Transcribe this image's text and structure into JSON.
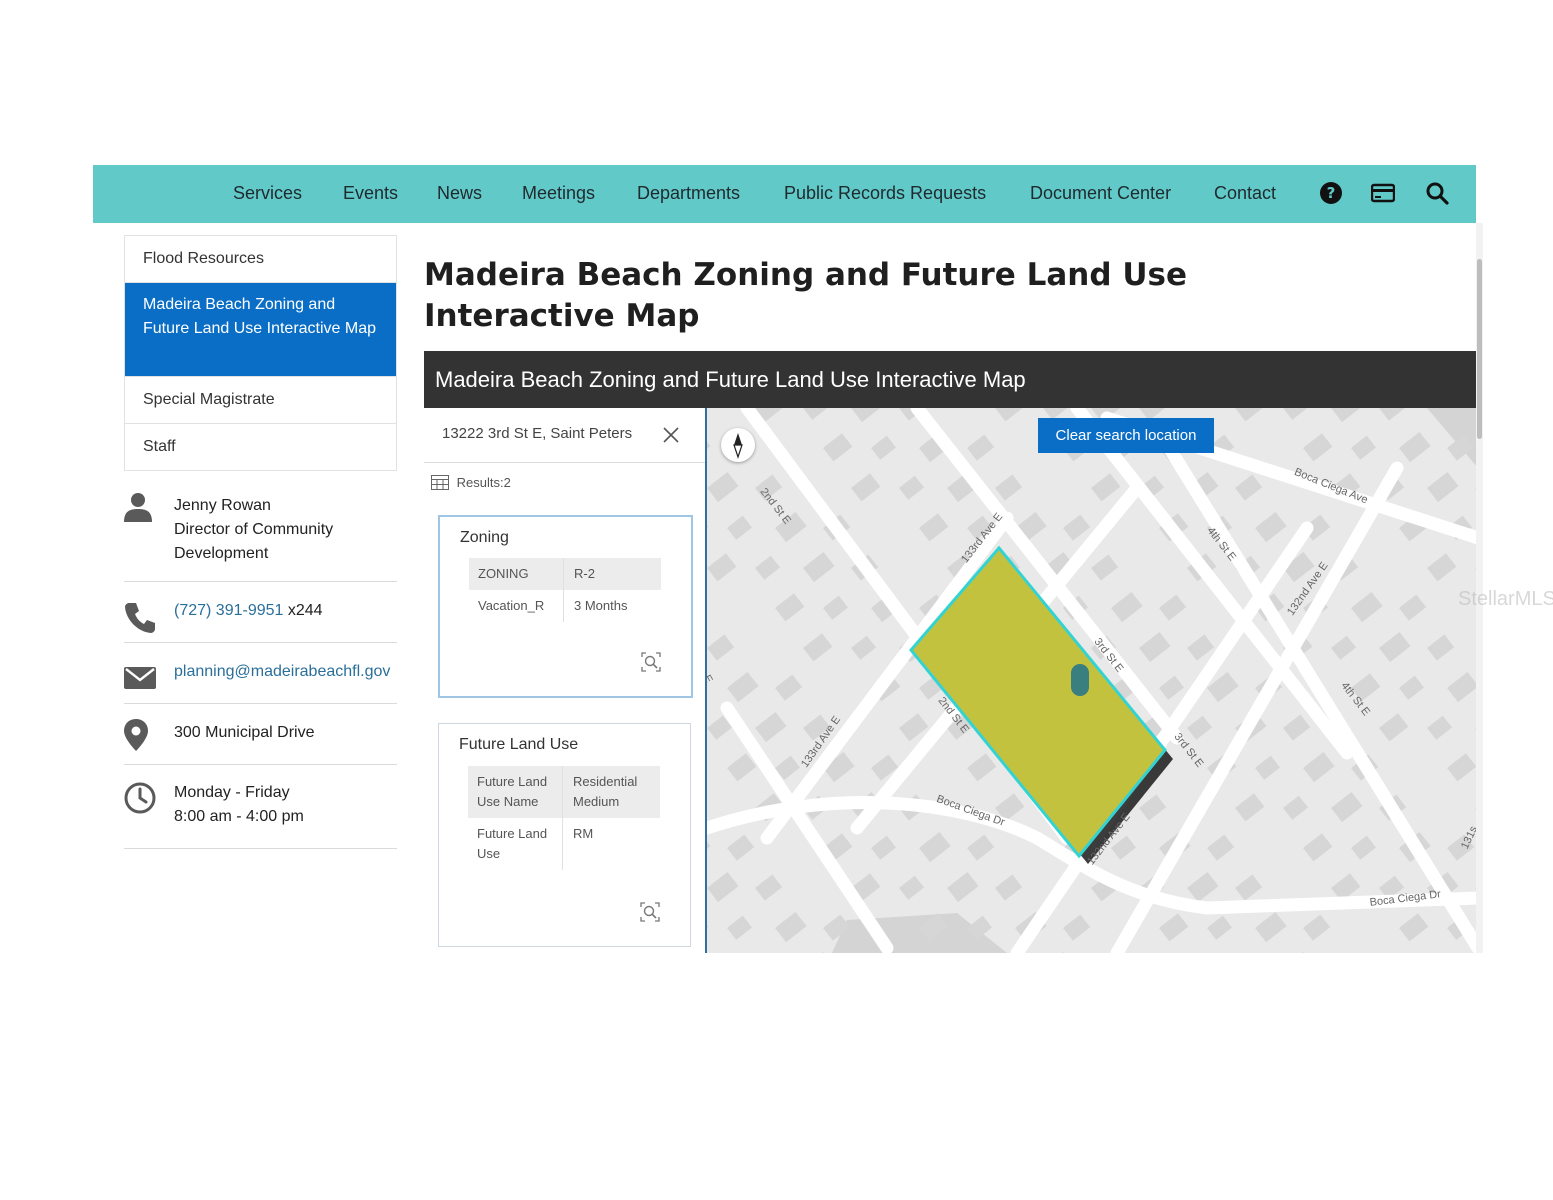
{
  "nav": {
    "items": [
      "Services",
      "Events",
      "News",
      "Meetings",
      "Departments",
      "Public Records Requests",
      "Document Center",
      "Contact"
    ],
    "icons": [
      "help-icon",
      "payment-card-icon",
      "search-icon"
    ],
    "background": "#62c9c9"
  },
  "sidebar": {
    "items": [
      "Flood Resources",
      "Madeira Beach Zoning and Future Land Use Interactive Map",
      "Special Magistrate",
      "Staff"
    ],
    "active_index": 1,
    "active_color": "#0a6ec6"
  },
  "contact": {
    "name": "Jenny Rowan",
    "title": "Director of Community Development",
    "phone": "(727) 391-9951",
    "phone_ext": "x244",
    "email": "planning@madeirabeachfl.gov",
    "address": "300 Municipal Drive",
    "hours_days": "Monday - Friday",
    "hours_time": "8:00 am - 4:00 pm"
  },
  "page": {
    "title": "Madeira Beach Zoning and Future Land Use Interactive Map"
  },
  "map_panel": {
    "header": "Madeira Beach Zoning and Future Land Use Interactive Map",
    "search_value": "13222 3rd St E, Saint Peters",
    "results_label": "Results:2",
    "cards": [
      {
        "title": "Zoning",
        "rows": [
          {
            "key": "ZONING",
            "value": "R-2"
          },
          {
            "key": "Vacation_R",
            "value": "3 Months"
          }
        ]
      },
      {
        "title": "Future Land Use",
        "rows": [
          {
            "key": "Future Land Use Name",
            "value": "Residential Medium"
          },
          {
            "key": "Future Land Use",
            "value": "RM"
          }
        ]
      }
    ]
  },
  "map": {
    "clear_button": "Clear search location",
    "parcel_color": "#c2c23e",
    "outline_color": "#34d3d3",
    "streets": [
      "Boca Ciega Ave",
      "2nd St E",
      "133rd Ave E",
      "4th St E",
      "132nd Ave E",
      "3rd St E",
      "E",
      "2nd St E",
      "133rd Ave E",
      "3rd St E",
      "4th St E",
      "Boca Ciega Dr",
      "132nd Ave E",
      "Boca Ciega Dr",
      "131s"
    ]
  },
  "watermark": "StellarMLS"
}
